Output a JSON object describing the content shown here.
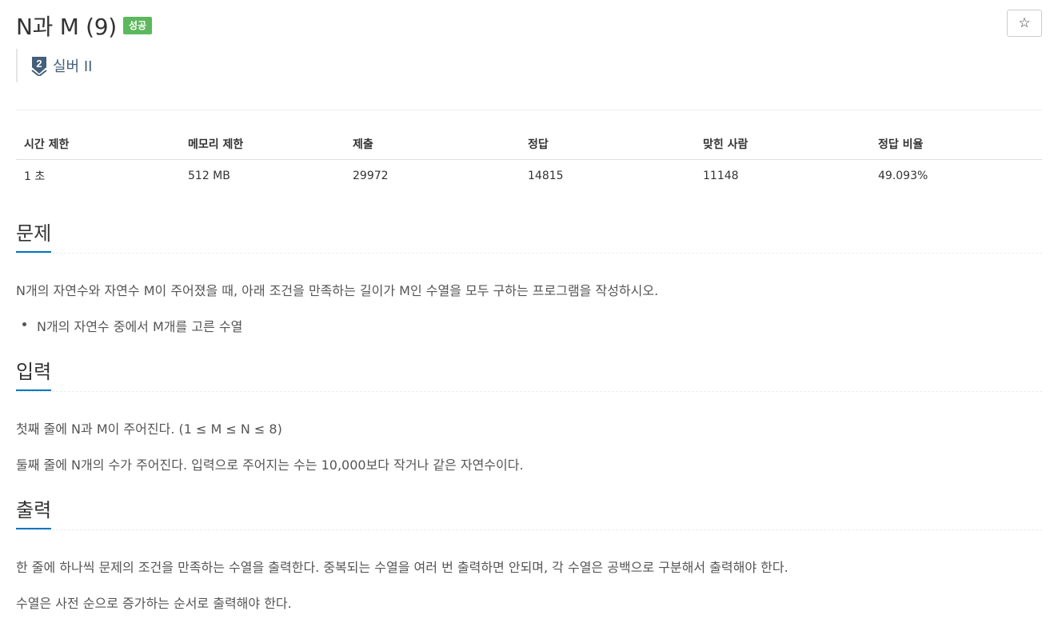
{
  "problem": {
    "title": "N과 M (9)",
    "status_badge": "성공",
    "star_icon": "☆",
    "tier": {
      "number": "2",
      "label": "실버 II",
      "color": "#435f7a"
    }
  },
  "info_table": {
    "headers": [
      "시간 제한",
      "메모리 제한",
      "제출",
      "정답",
      "맞힌 사람",
      "정답 비율"
    ],
    "values": [
      "1 초",
      "512 MB",
      "29972",
      "14815",
      "11148",
      "49.093%"
    ]
  },
  "sections": {
    "description": {
      "title": "문제",
      "text": "N개의 자연수와 자연수 M이 주어졌을 때, 아래 조건을 만족하는 길이가 M인 수열을 모두 구하는 프로그램을 작성하시오.",
      "bullets": [
        "N개의 자연수 중에서 M개를 고른 수열"
      ]
    },
    "input": {
      "title": "입력",
      "lines": [
        "첫째 줄에 N과 M이 주어진다. (1 ≤ M ≤ N ≤ 8)",
        "둘째 줄에 N개의 수가 주어진다. 입력으로 주어지는 수는 10,000보다 작거나 같은 자연수이다."
      ]
    },
    "output": {
      "title": "출력",
      "lines": [
        "한 줄에 하나씩 문제의 조건을 만족하는 수열을 출력한다. 중복되는 수열을 여러 번 출력하면 안되며, 각 수열은 공백으로 구분해서 출력해야 한다.",
        "수열은 사전 순으로 증가하는 순서로 출력해야 한다."
      ]
    }
  },
  "colors": {
    "badge_success": "#5cb85c",
    "section_underline": "#0076c0",
    "tier": "#435f7a"
  }
}
